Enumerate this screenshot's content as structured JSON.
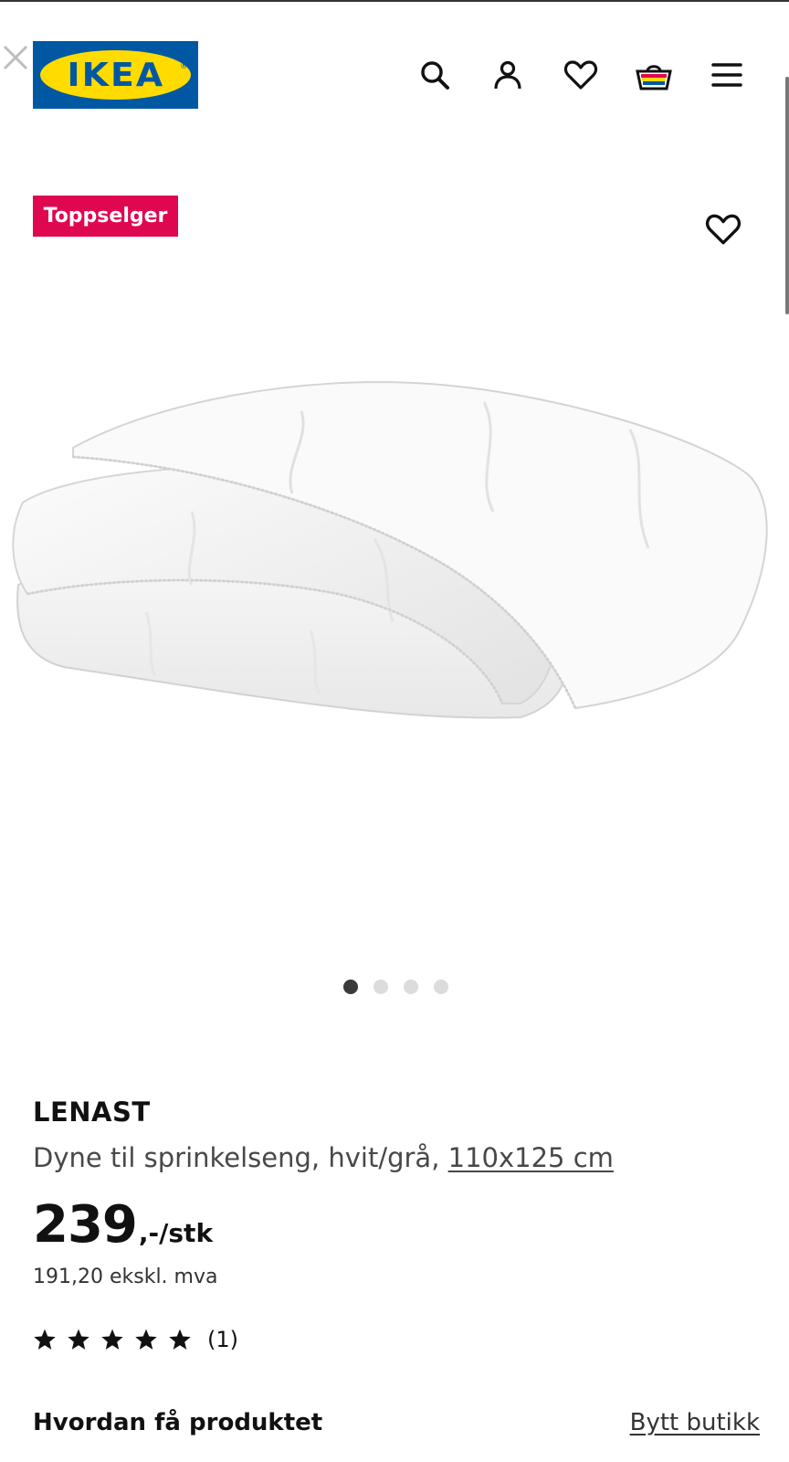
{
  "header": {
    "logo_text": "IKEA",
    "logo_colors": {
      "blue": "#0058a3",
      "yellow": "#ffdb00"
    },
    "icons": [
      "close-icon",
      "search-icon",
      "account-icon",
      "wishlist-icon",
      "cart-icon",
      "menu-icon"
    ]
  },
  "product": {
    "badge": "Toppselger",
    "badge_color": "#e00751",
    "name": "LENAST",
    "description": "Dyne til sprinkelseng, hvit/grå, ",
    "size": "110x125 cm",
    "price": "239",
    "price_unit": ",-/stk",
    "price_ex_vat": "191,20 ekskl. mva",
    "rating_stars": 5,
    "rating_count": "(1)",
    "image_count": 4,
    "active_image": 1
  },
  "delivery": {
    "title": "Hvordan få produktet",
    "change_store": "Bytt butikk"
  }
}
